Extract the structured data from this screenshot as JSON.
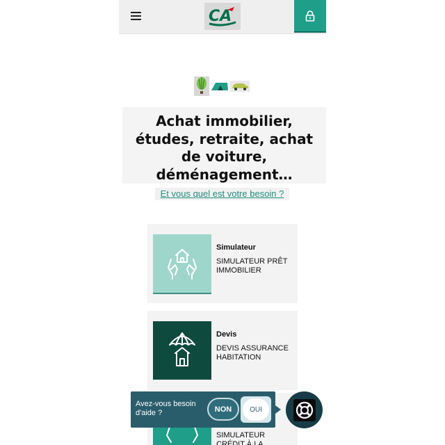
{
  "header": {
    "menu_icon": "hamburger-menu-icon",
    "logo_text": "CA",
    "lock_icon": "lock-icon"
  },
  "hero": {
    "icons": [
      "hot-air-balloon-icon",
      "tent-icon",
      "car-icon"
    ],
    "headline": "Achat immobilier, études, retraite, achat de voiture, déménagement…",
    "subline": "Et vous quel est votre besoin ?"
  },
  "cards": [
    {
      "kicker": "Simulateur",
      "title": "SIMULATEUR PRÊT IMMOBILIER",
      "icon": "house-in-hands-icon",
      "icon_bg": "#9fd6cc"
    },
    {
      "kicker": "Devis",
      "title": "DEVIS ASSURANCE HABITATION",
      "icon": "umbrella-house-icon",
      "icon_bg": "#0f4a3e"
    },
    {
      "kicker": "",
      "title": "SIMULATEUR CRÉDIT À LA",
      "icon": "car-in-hands-icon",
      "icon_bg": "#1f9e8a"
    }
  ],
  "help": {
    "question": "Avez-vous besoin d'aide ?",
    "no_label": "NON",
    "yes_label": "OUI",
    "launcher_icon": "lifebuoy-icon"
  },
  "colors": {
    "accent": "#1f9e8a",
    "dark_green": "#0f4a3e",
    "help_bg": "#2a5d6b",
    "logo_red": "#e2001a",
    "logo_green": "#00704a"
  }
}
